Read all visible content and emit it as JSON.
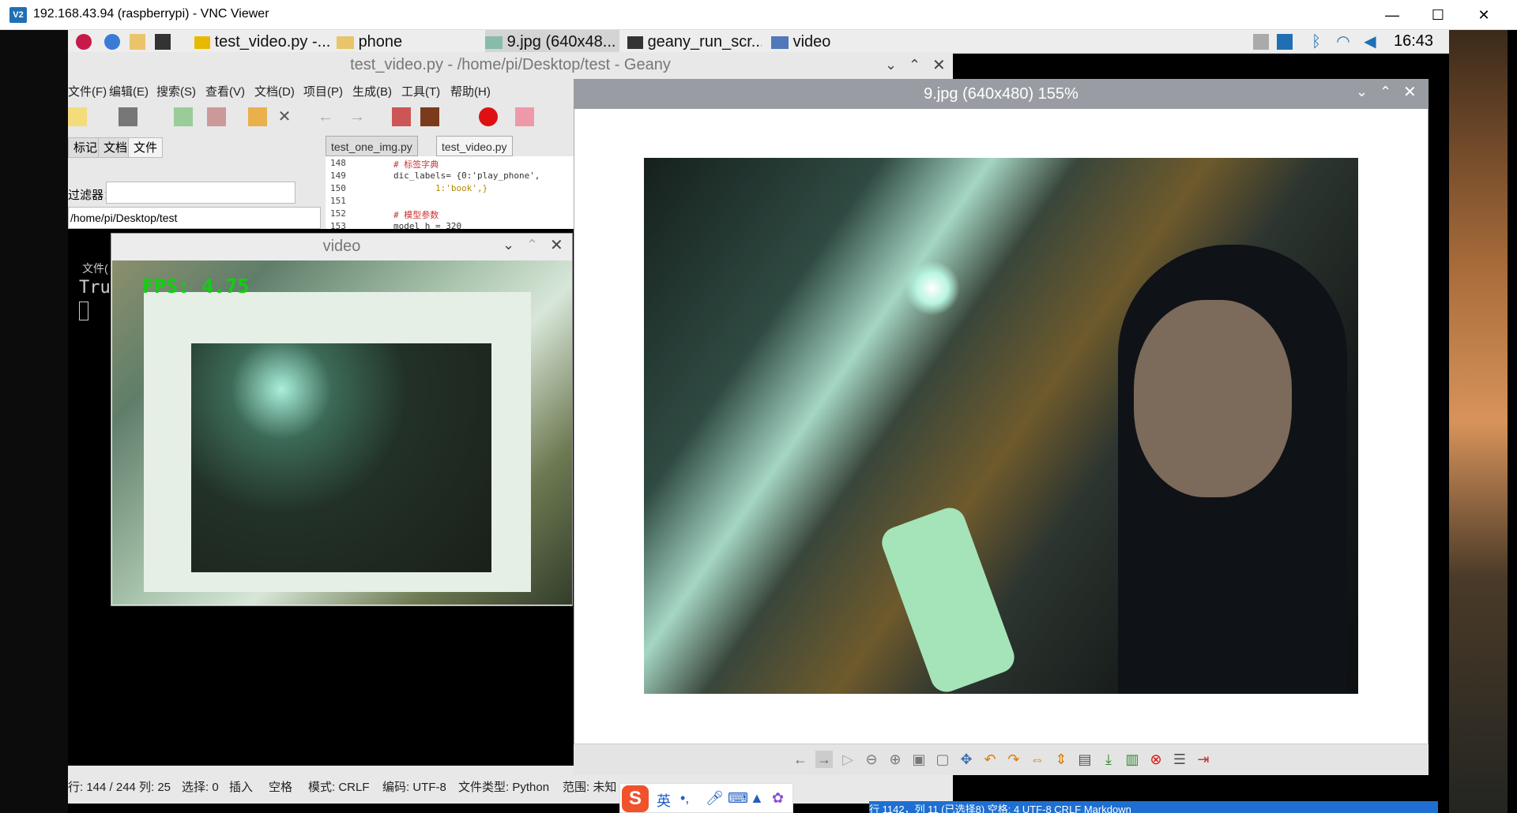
{
  "vnc": {
    "title": "192.168.43.94 (raspberrypi) - VNC Viewer",
    "logo": "V2",
    "minimize": "—",
    "maximize": "☐",
    "close": "✕"
  },
  "taskbar": {
    "items": [
      {
        "label": "test_video.py -..."
      },
      {
        "label": "phone"
      },
      {
        "label": "9.jpg (640x48..."
      },
      {
        "label": "geany_run_scr..."
      },
      {
        "label": "video"
      }
    ],
    "clock": "16:43"
  },
  "geany": {
    "title": "test_video.py - /home/pi/Desktop/test - Geany",
    "menu": [
      "文件(F)",
      "编辑(E)",
      "搜索(S)",
      "查看(V)",
      "文档(D)",
      "项目(P)",
      "生成(B)",
      "工具(T)",
      "帮助(H)"
    ],
    "sidebar_tabs": [
      "标记",
      "文档",
      "文件"
    ],
    "filter_label": "过滤器：",
    "path": "/home/pi/Desktop/test",
    "editor_tabs": [
      "test_one_img.py",
      "test_video.py"
    ],
    "code_lines": [
      {
        "n": "148",
        "text": "# 标签字典"
      },
      {
        "n": "149",
        "text": "dic_labels= {0:'play_phone',"
      },
      {
        "n": "150",
        "text": "        1:'book',}"
      },
      {
        "n": "151",
        "text": ""
      },
      {
        "n": "152",
        "text": "# 模型参数"
      },
      {
        "n": "153",
        "text": "model_h = 320"
      }
    ],
    "terminal_text": "Tru",
    "terminal_file_label": "文件(",
    "status": {
      "line": "行: 144 / 244",
      "col": "列: 25",
      "sel": "选择: 0",
      "ins": "插入",
      "space": "空格",
      "mode": "模式: CRLF",
      "enc": "编码: UTF-8",
      "type": "文件类型: Python",
      "scope": "范围: 未知"
    }
  },
  "video": {
    "title": "video",
    "fps": "FPS: 4.75"
  },
  "viewer": {
    "title": "9.jpg (640x480) 155%"
  },
  "ime": {
    "lang": "英",
    "punct": "•,"
  },
  "bottom_strip": "行 1142，列 11 (已选择8)   空格: 4   UTF-8   CRLF   Markdown"
}
